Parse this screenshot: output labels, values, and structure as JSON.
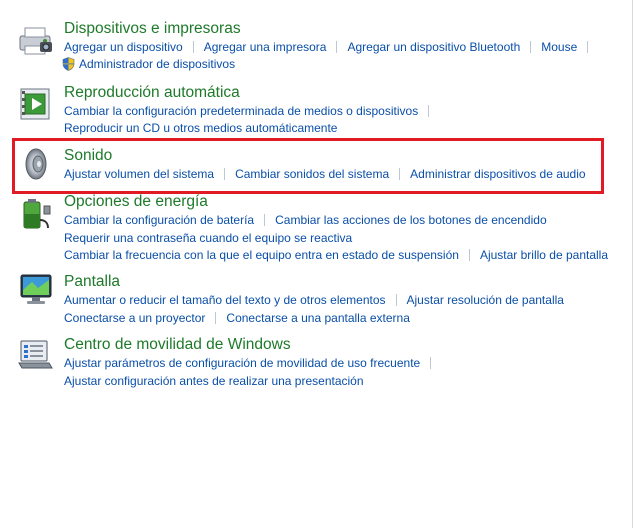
{
  "categories": [
    {
      "id": "devices",
      "icon": "printer-camera-icon",
      "title": "Dispositivos e impresoras",
      "lines": [
        [
          "Agregar un dispositivo",
          "Agregar una impresora",
          "Agregar un dispositivo Bluetooth",
          "Mouse"
        ],
        [
          "Administrador de dispositivos"
        ]
      ]
    },
    {
      "id": "autoplay",
      "icon": "autoplay-icon",
      "title": "Reproducción automática",
      "lines": [
        [
          "Cambiar la configuración predeterminada de medios o dispositivos"
        ],
        [
          "Reproducir un CD u otros medios automáticamente"
        ]
      ]
    },
    {
      "id": "sound",
      "icon": "speaker-icon",
      "title": "Sonido",
      "lines": [
        [
          "Ajustar volumen del sistema",
          "Cambiar sonidos del sistema",
          "Administrar dispositivos de audio"
        ]
      ]
    },
    {
      "id": "power",
      "icon": "battery-plug-icon",
      "title": "Opciones de energía",
      "lines": [
        [
          "Cambiar la configuración de batería",
          "Cambiar las acciones de los botones de encendido"
        ],
        [
          "Requerir una contraseña cuando el equipo se reactiva"
        ],
        [
          "Cambiar la frecuencia con la que el equipo entra en estado de suspensión",
          "Ajustar brillo de pantalla"
        ]
      ]
    },
    {
      "id": "display",
      "icon": "monitor-icon",
      "title": "Pantalla",
      "lines": [
        [
          "Aumentar o reducir el tamaño del texto y de otros elementos",
          "Ajustar resolución de pantalla"
        ],
        [
          "Conectarse a un proyector",
          "Conectarse a una pantalla externa"
        ]
      ]
    },
    {
      "id": "mobility",
      "icon": "mobility-center-icon",
      "title": "Centro de movilidad de Windows",
      "lines": [
        [
          "Ajustar parámetros de configuración de movilidad de uso frecuente"
        ],
        [
          "Ajustar configuración antes de realizar una presentación"
        ]
      ]
    }
  ],
  "colors": {
    "title": "#1e7a2a",
    "link": "#0a4fa8",
    "highlight": "#e01b24"
  }
}
